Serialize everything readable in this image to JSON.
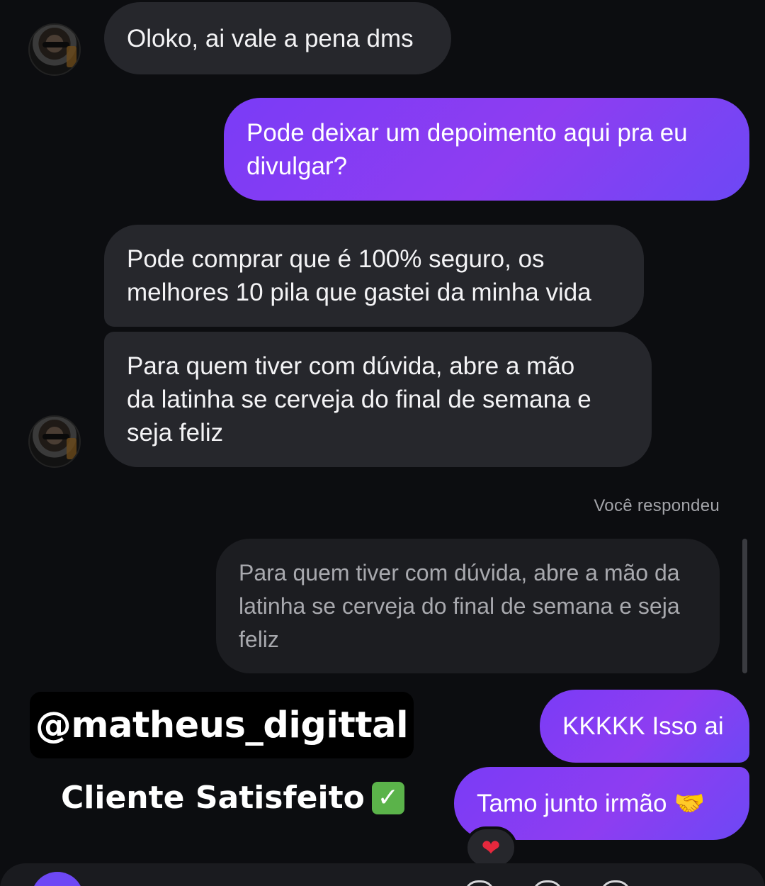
{
  "messages": {
    "m1": {
      "text": "Oloko, ai vale a pena dms"
    },
    "m2": {
      "lines": [
        "Pode deixar um depoimento aqui pra eu",
        "divulgar?"
      ]
    },
    "m3": {
      "lines": [
        "Pode comprar que é 100% seguro, os",
        "melhores 10 pila que gastei da minha vida"
      ]
    },
    "m4": {
      "lines": [
        "Para quem tiver com dúvida, abre a mão",
        "da latinha se cerveja do final de semana e",
        "seja feliz"
      ]
    },
    "reply_meta": "Você respondeu",
    "m5_quoted": {
      "lines": [
        "Para quem tiver com dúvida, abre a mão da",
        "latinha se cerveja do final de semana e seja",
        "feliz"
      ]
    },
    "m6": {
      "text": "KKKKK Isso ai"
    },
    "m7": {
      "text": "Tamo junto irmão",
      "emoji": "🤝"
    },
    "reaction": "❤"
  },
  "overlay": {
    "handle": "@matheus_digittal",
    "caption": "Cliente Satisfeito",
    "caption_icon": "✓"
  },
  "icons": {
    "avatar": "contact-avatar",
    "reaction": "heart-icon",
    "check": "check-mark-icon"
  },
  "colors": {
    "sent_bubble": "#8e3df1",
    "received_bubble": "#26272c",
    "background": "#0c0d10",
    "reaction_heart": "#e6283d",
    "check_badge": "#5bb34a"
  }
}
